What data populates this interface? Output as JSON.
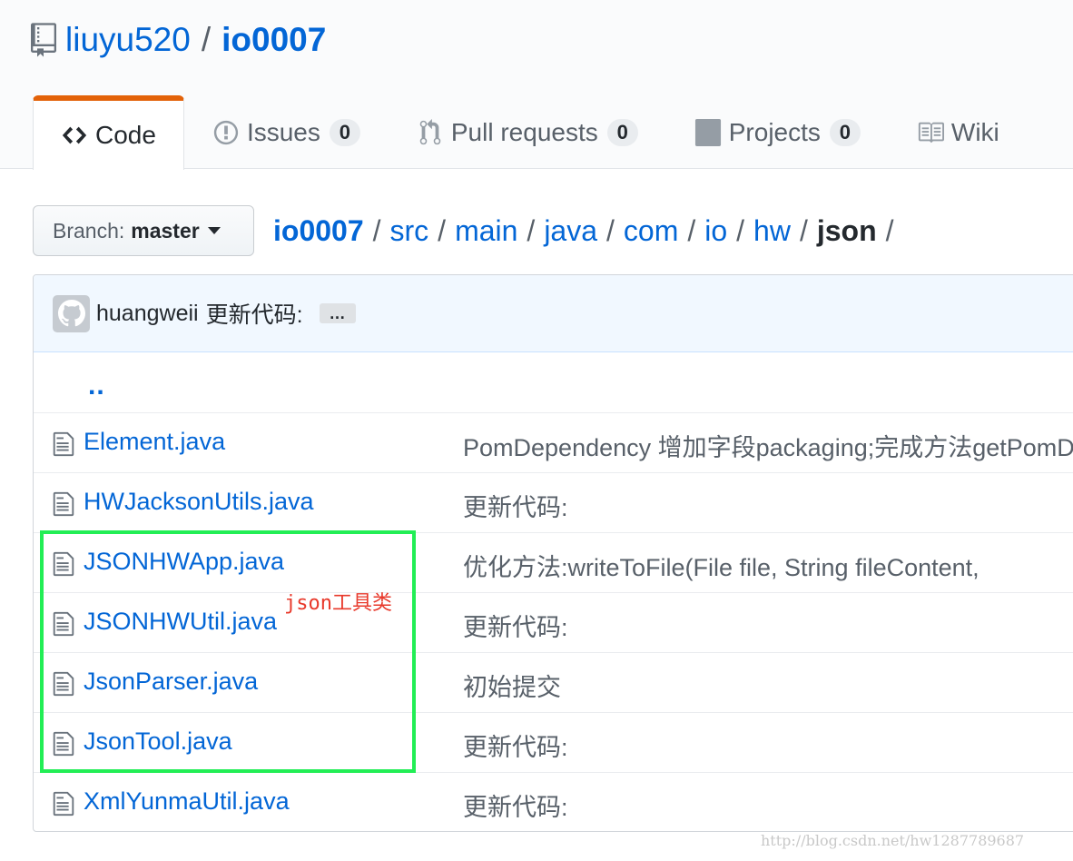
{
  "repo": {
    "owner": "liuyu520",
    "separator": "/",
    "name": "io0007"
  },
  "tabs": [
    {
      "label": "Code",
      "icon": "code-icon",
      "selected": true
    },
    {
      "label": "Issues",
      "icon": "issue-icon",
      "count": "0"
    },
    {
      "label": "Pull requests",
      "icon": "pull-request-icon",
      "count": "0"
    },
    {
      "label": "Projects",
      "icon": "project-icon",
      "count": "0"
    },
    {
      "label": "Wiki",
      "icon": "book-icon"
    }
  ],
  "branch": {
    "prefix": "Branch:",
    "name": "master"
  },
  "breadcrumb": {
    "parts": [
      "io0007",
      "src",
      "main",
      "java",
      "com",
      "io",
      "hw"
    ],
    "current": "json",
    "separator": "/"
  },
  "commit": {
    "author": "huangweii",
    "message": "更新代码:",
    "more": "…"
  },
  "parent_dir": "..",
  "files": [
    {
      "name": "Element.java",
      "message": "PomDependency 增加字段packaging;完成方法getPomDependency"
    },
    {
      "name": "HWJacksonUtils.java",
      "message": "更新代码:"
    },
    {
      "name": "JSONHWApp.java",
      "message": "优化方法:writeToFile(File file, String fileContent,"
    },
    {
      "name": "JSONHWUtil.java",
      "message": "更新代码:"
    },
    {
      "name": "JsonParser.java",
      "message": "初始提交"
    },
    {
      "name": "JsonTool.java",
      "message": "更新代码:"
    },
    {
      "name": "XmlYunmaUtil.java",
      "message": "更新代码:"
    }
  ],
  "annotation": "json工具类",
  "watermark": "http://blog.csdn.net/hw1287789687",
  "colors": {
    "link": "#0366d6",
    "tab_accent": "#e36209",
    "highlight": "#22ee55",
    "annotation": "#e8392b"
  }
}
